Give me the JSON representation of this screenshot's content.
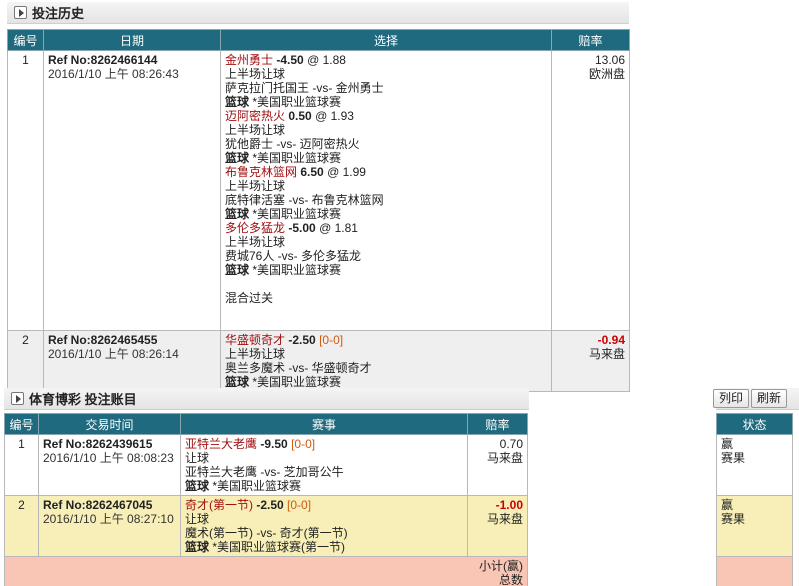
{
  "history": {
    "title": "投注历史",
    "headers": [
      "编号",
      "日期",
      "选择",
      "赔率"
    ],
    "rows": [
      {
        "num": "1",
        "ref": "Ref No:8262466144",
        "date": "2016/1/10 上午 08:26:43",
        "legs": [
          {
            "team": "金州勇士",
            "line": "-4.50",
            "at": "@ 1.88",
            "market": "上半场让球",
            "match": "萨克拉门托国王 -vs- 金州勇士",
            "sport": "篮球",
            "league": "*美国职业篮球赛"
          },
          {
            "team": "迈阿密热火",
            "line": "0.50",
            "at": "@ 1.93",
            "market": "上半场让球",
            "match": "犹他爵士 -vs- 迈阿密热火",
            "sport": "篮球",
            "league": "*美国职业篮球赛"
          },
          {
            "team": "布鲁克林篮网",
            "line": "6.50",
            "at": "@ 1.99",
            "market": "上半场让球",
            "match": "底特律活塞 -vs- 布鲁克林篮网",
            "sport": "篮球",
            "league": "*美国职业篮球赛"
          },
          {
            "team": "多伦多猛龙",
            "line": "-5.00",
            "at": "@ 1.81",
            "market": "上半场让球",
            "match": "费城76人 -vs- 多伦多猛龙",
            "sport": "篮球",
            "league": "*美国职业篮球赛"
          }
        ],
        "footer": "混合过关",
        "odds": "13.06",
        "odds_type": "欧洲盘"
      },
      {
        "num": "2",
        "ref": "Ref No:8262465455",
        "date": "2016/1/10 上午 08:26:14",
        "legs": [
          {
            "team": "华盛顿奇才",
            "line": "-2.50",
            "score": "[0-0]",
            "market": "上半场让球",
            "match": "奥兰多魔术 -vs- 华盛顿奇才",
            "sport": "篮球",
            "league": "*美国职业篮球赛"
          }
        ],
        "odds": "-0.94",
        "odds_type": "马来盘"
      }
    ]
  },
  "ledger": {
    "title": "体育博彩 投注账目",
    "print_label": "列印",
    "refresh_label": "刷新",
    "headers": [
      "编号",
      "交易时间",
      "赛事",
      "赔率"
    ],
    "status_header": "状态",
    "rows": [
      {
        "num": "1",
        "ref": "Ref No:8262439615",
        "date": "2016/1/10 上午 08:08:23",
        "team": "亚特兰大老鹰",
        "line": "-9.50",
        "score": "[0-0]",
        "market": "让球",
        "match": "亚特兰大老鹰 -vs- 芝加哥公牛",
        "sport": "篮球",
        "league": "*美国职业篮球赛",
        "odds": "0.70",
        "odds_type": "马来盘",
        "status": "赢",
        "status2": "赛果"
      },
      {
        "num": "2",
        "ref": "Ref No:8262467045",
        "date": "2016/1/10 上午 08:27:10",
        "team": "奇才(第一节)",
        "line": "-2.50",
        "score": "[0-0]",
        "market": "让球",
        "match": "魔术(第一节) -vs- 奇才(第一节)",
        "sport": "篮球",
        "league": "*美国职业篮球赛(第一节)",
        "odds": "-1.00",
        "odds_type": "马来盘",
        "status": "赢",
        "status2": "赛果"
      }
    ],
    "subtotal_label": "小计(赢)",
    "total_label": "总数"
  }
}
